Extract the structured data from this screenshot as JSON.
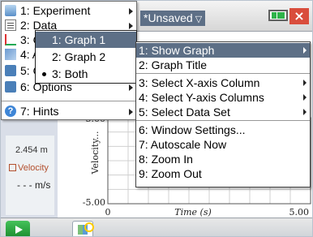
{
  "titlebar": {
    "doc_title": "*Unsaved",
    "caret": "▽"
  },
  "menu": {
    "items": [
      {
        "label": "1: Experiment",
        "icon": "experiment-icon",
        "has_submenu": true
      },
      {
        "label": "2: Data",
        "icon": "data-icon",
        "has_submenu": true
      },
      {
        "label": "3: Graph",
        "icon": "graph-icon",
        "has_submenu": true
      },
      {
        "label": "4: Analyze",
        "icon": "analyze-icon",
        "has_submenu": true
      },
      {
        "label": "5: Options",
        "icon": "options-icon",
        "has_submenu": true
      },
      {
        "label": "6: Options",
        "icon": "options-icon",
        "has_submenu": true
      },
      {
        "label": "7: Hints",
        "icon": "hints-icon",
        "has_submenu": true
      }
    ],
    "data_submenu": [
      {
        "label": "1: Graph 1",
        "selected": true
      },
      {
        "label": "2: Graph 2",
        "selected": false
      },
      {
        "label": "3: Both",
        "selected": false,
        "bullet": true
      }
    ],
    "graph_submenu": [
      {
        "label": "1: Show Graph",
        "selected": true,
        "has_submenu": true
      },
      {
        "label": "2: Graph Title",
        "selected": false,
        "has_submenu": false
      },
      {
        "label": "3: Select X-axis Column",
        "selected": false,
        "has_submenu": true
      },
      {
        "label": "4: Select Y-axis Columns",
        "selected": false,
        "has_submenu": true
      },
      {
        "label": "5: Select Data Set",
        "selected": false,
        "has_submenu": true
      },
      {
        "label": "6: Window Settings...",
        "selected": false,
        "has_submenu": false
      },
      {
        "label": "7: Autoscale Now",
        "selected": false,
        "has_submenu": false
      },
      {
        "label": "8: Zoom In",
        "selected": false,
        "has_submenu": false
      },
      {
        "label": "9: Zoom Out",
        "selected": false,
        "has_submenu": false
      }
    ]
  },
  "meter": {
    "top_value": "2.454 m",
    "name": "Velocity",
    "value": "- - - m/s"
  },
  "chart_data": {
    "type": "line",
    "xlabel": "Time (s)",
    "ylabel": "Velocity...",
    "xlim": [
      0,
      5
    ],
    "ylim": [
      -5,
      5
    ],
    "x_ticks": [
      "0",
      "5.00"
    ],
    "y_ticks": [
      "5.00",
      "-5.00"
    ],
    "grid": true,
    "series": []
  },
  "colors": {
    "accent": "#5d6f86",
    "meter_panel": "#d9dee8",
    "velocity": "#b3502e",
    "play": "#2fb34a"
  }
}
